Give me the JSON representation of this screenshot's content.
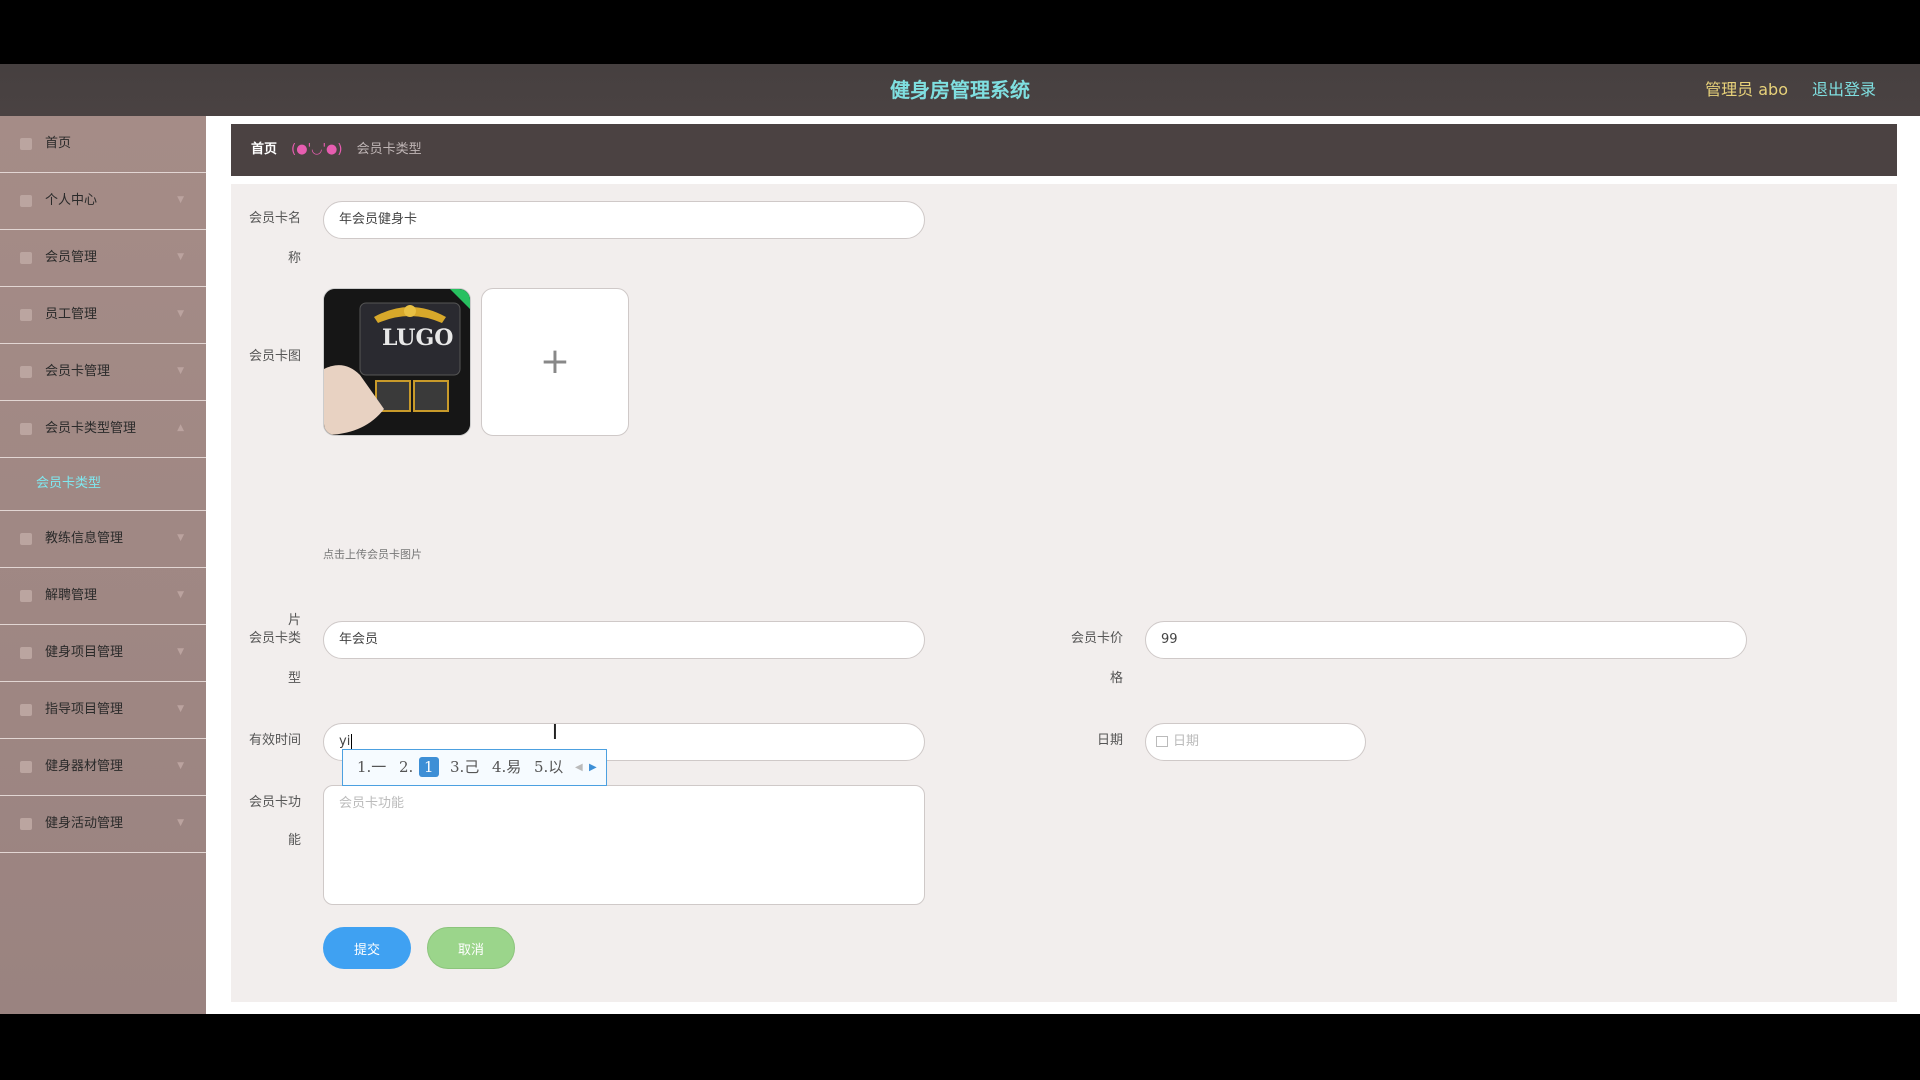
{
  "header": {
    "title": "健身房管理系统",
    "admin_label": "管理员 abo",
    "logout_label": "退出登录"
  },
  "sidebar": {
    "items": [
      {
        "label": "首页",
        "icon": "home-icon"
      },
      {
        "label": "个人中心",
        "icon": "user-icon"
      },
      {
        "label": "会员管理",
        "icon": "flag-icon"
      },
      {
        "label": "员工管理",
        "icon": "users-icon"
      },
      {
        "label": "会员卡管理",
        "icon": "card-icon"
      },
      {
        "label": "会员卡类型管理",
        "icon": "list-icon"
      }
    ],
    "active_sub_item": "会员卡类型",
    "items_after": [
      {
        "label": "教练信息管理",
        "icon": "clock-icon"
      },
      {
        "label": "解聘管理",
        "icon": "send-icon"
      },
      {
        "label": "健身项目管理",
        "icon": "calendar-icon"
      },
      {
        "label": "指导项目管理",
        "icon": "calendar-icon"
      },
      {
        "label": "健身器材管理",
        "icon": "user-icon"
      },
      {
        "label": "健身活动管理",
        "icon": "chat-icon"
      }
    ]
  },
  "breadcrumb": {
    "home": "首页",
    "separator": "(●'◡'●)",
    "current": "会员卡类型"
  },
  "form": {
    "card_name_label_1": "会员卡名",
    "card_name_label_2": "称",
    "card_name_value": "年会员健身卡",
    "card_image_label_1": "会员卡图",
    "card_image_label_2": "片",
    "card_image_hint": "点击上传会员卡图片",
    "card_image_brand": "LUGO",
    "card_type_label_1": "会员卡类",
    "card_type_label_2": "型",
    "card_type_value": "年会员",
    "card_price_label_1": "会员卡价",
    "card_price_label_2": "格",
    "card_price_value": "99",
    "valid_time_label": "有效时间",
    "valid_time_value": "yi",
    "date_label": "日期",
    "date_placeholder": "日期",
    "function_label_1": "会员卡功",
    "function_label_2": "能",
    "function_placeholder": "会员卡功能",
    "submit_label": "提交",
    "cancel_label": "取消"
  },
  "ime": {
    "candidates": [
      "1.一",
      "2.",
      "1",
      "3.己",
      "4.易",
      "5.以"
    ]
  }
}
